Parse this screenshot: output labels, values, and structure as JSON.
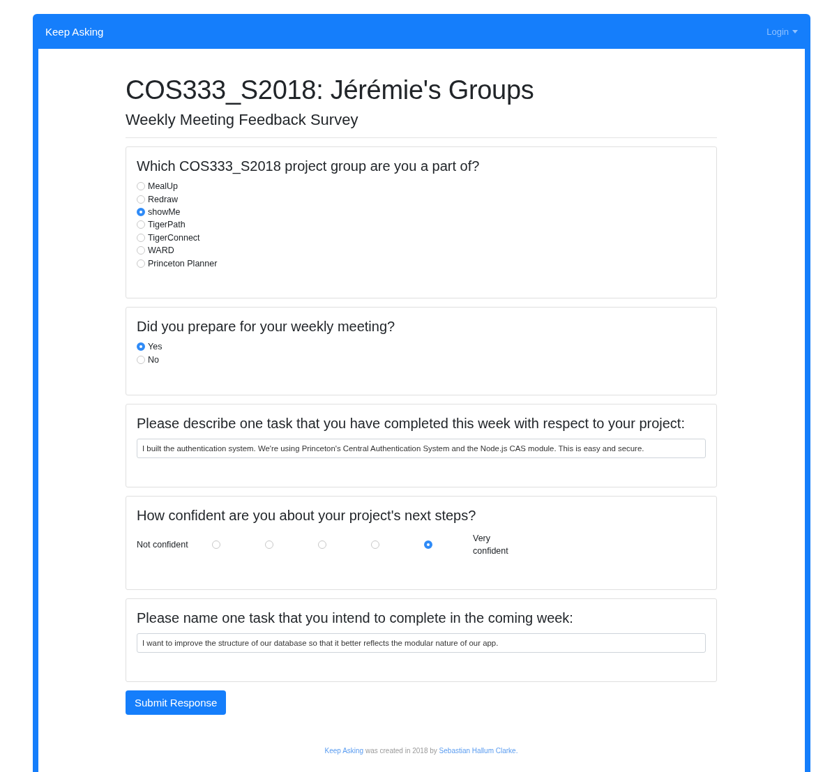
{
  "navbar": {
    "brand": "Keep Asking",
    "login": "Login"
  },
  "title": "COS333_S2018: Jérémie's Groups",
  "subtitle": "Weekly Meeting Feedback Survey",
  "questions": [
    {
      "kind": "radio",
      "prompt": "Which COS333_S2018 project group are you a part of?",
      "options": [
        {
          "label": "MealUp",
          "selected": false
        },
        {
          "label": "Redraw",
          "selected": false
        },
        {
          "label": "showMe",
          "selected": true
        },
        {
          "label": "TigerPath",
          "selected": false
        },
        {
          "label": "TigerConnect",
          "selected": false
        },
        {
          "label": "WARD",
          "selected": false
        },
        {
          "label": "Princeton Planner",
          "selected": false
        }
      ]
    },
    {
      "kind": "radio",
      "prompt": "Did you prepare for your weekly meeting?",
      "options": [
        {
          "label": "Yes",
          "selected": true
        },
        {
          "label": "No",
          "selected": false
        }
      ]
    },
    {
      "kind": "text",
      "prompt": "Please describe one task that you have completed this week with respect to your project:",
      "value": "I built the authentication system. We're using Princeton's Central Authentication System and the Node.js CAS module. This is easy and secure."
    },
    {
      "kind": "scale",
      "prompt": "How confident are you about your project's next steps?",
      "low": "Not confident",
      "high": "Very confident",
      "points": [
        {
          "selected": false
        },
        {
          "selected": false
        },
        {
          "selected": false
        },
        {
          "selected": false
        },
        {
          "selected": true
        }
      ]
    },
    {
      "kind": "text",
      "prompt": "Please name one task that you intend to complete in the coming week:",
      "value": "I want to improve the structure of our database so that it better reflects the modular nature of our app."
    }
  ],
  "submit": "Submit Response",
  "footer": {
    "brand_link": "Keep Asking",
    "text": "was created in 2018 by",
    "author_link": "Sebastian Hallum Clarke."
  }
}
